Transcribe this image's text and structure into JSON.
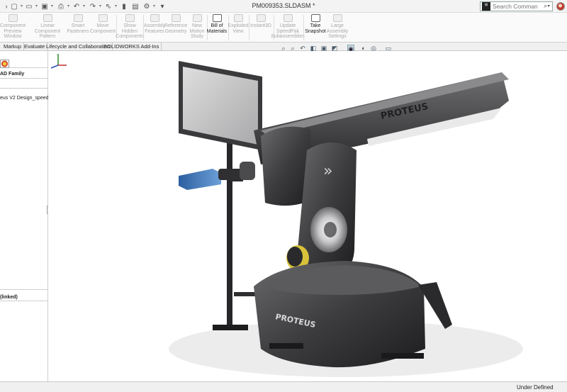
{
  "window": {
    "title": "PM009353.SLDASM *"
  },
  "search": {
    "placeholder": "Search Commands",
    "prefix_icon": "solidworks-icon"
  },
  "command_manager": {
    "buttons": [
      {
        "label": "Component Preview Window",
        "enabled": false
      },
      {
        "label": "Linear Component Pattern",
        "enabled": false
      },
      {
        "label": "Smart Fasteners",
        "enabled": false
      },
      {
        "label": "Move Component",
        "enabled": false
      },
      {
        "label": "Show Hidden Components",
        "enabled": false
      },
      {
        "label": "Assembly Features",
        "enabled": false
      },
      {
        "label": "Reference Geometry",
        "enabled": false
      },
      {
        "label": "New Motion Study",
        "enabled": false
      },
      {
        "label": "Bill of Materials",
        "enabled": true
      },
      {
        "label": "Exploded View",
        "enabled": false
      },
      {
        "label": "Instant3D",
        "enabled": false
      },
      {
        "label": "Update SpeedPak Subassemblies",
        "enabled": false
      },
      {
        "label": "Take Snapshot",
        "enabled": true
      },
      {
        "label": "Large Assembly Settings",
        "enabled": false
      }
    ]
  },
  "tabs": [
    {
      "label": "Markup"
    },
    {
      "label": "Evaluate"
    },
    {
      "label": "Lifecycle and Collaboration"
    },
    {
      "label": "SOLIDWORKS Add-Ins"
    }
  ],
  "feature_tree": {
    "family_label": "AD Family",
    "top_item": "eus V2 Design_speedpak)",
    "bottom_item": "(linked)"
  },
  "model": {
    "brand_text": "PROTEUS"
  },
  "status_bar": {
    "state": "Under Defined"
  },
  "icons": {
    "quick_access": [
      "new-doc-icon",
      "open-icon",
      "save-icon",
      "print-icon",
      "undo-icon",
      "redo-icon",
      "select-icon",
      "rebuild-icon",
      "file-properties-icon",
      "options-icon"
    ],
    "heads_up": [
      "zoom-to-fit-icon",
      "zoom-area-icon",
      "previous-view-icon",
      "section-view-icon",
      "view-orientation-icon",
      "display-style-icon",
      "hide-show-icon",
      "edit-appearance-icon",
      "apply-scene-icon",
      "view-settings-icon"
    ]
  },
  "colors": {
    "accent_blue": "#4a82c4",
    "model_body": "#3c3c3e",
    "model_yellow": "#d9c23a"
  }
}
